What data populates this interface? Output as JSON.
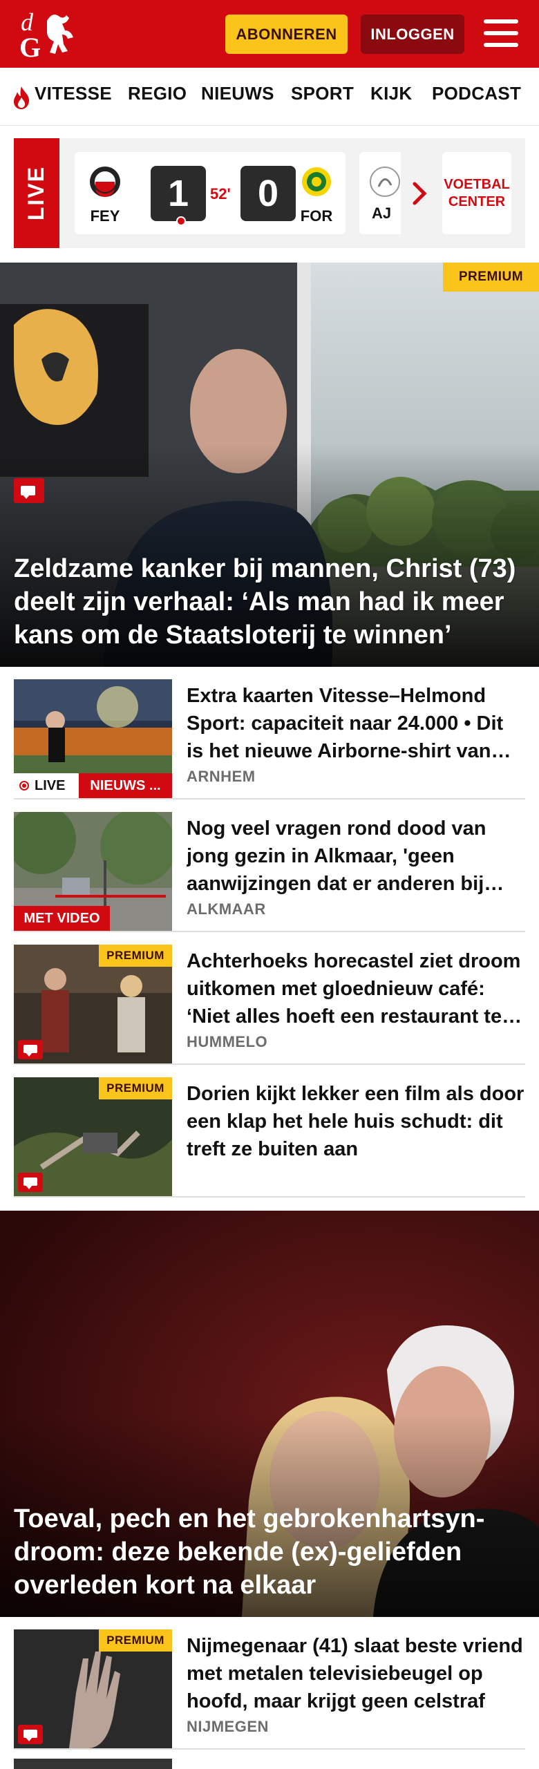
{
  "header": {
    "logo_text": "dG",
    "subscribe_label": "ABONNEREN",
    "login_label": "INLOGGEN",
    "menu_icon": "hamburger-icon",
    "brand_color": "#d10a11"
  },
  "nav": {
    "items": [
      "VITESSE",
      "REGIO",
      "NIEUWS",
      "SPORT",
      "KIJK",
      "PODCAST"
    ]
  },
  "live": {
    "label": "LIVE",
    "home_team": "FEY",
    "away_team": "FOR",
    "home_score": "1",
    "away_score": "0",
    "minute": "52'",
    "next_team": "AJ",
    "center_label_1": "VOETBAL",
    "center_label_2": "CENTER"
  },
  "hero": {
    "badge": "PREMIUM",
    "title": "Zeldzame kanker bij mannen, Christ (73) deelt zijn verhaal: ‘Als man had ik meer kans om de Staatsloterij te winnen’"
  },
  "articles": [
    {
      "title": "Extra kaarten Vitesse–Helmond Sport: capaciteit naar 24.000 • Dit is het nieuwe Airborne-shirt van Vitesse",
      "city": "ARNHEM",
      "live_label": "LIVE",
      "tag": "NIEUWS ..."
    },
    {
      "title": "Nog veel vragen rond dood van jong gezin in Alkmaar, 'geen aanwijzingen dat er anderen bij betrokken zijn'",
      "city": "ALKMAAR",
      "tag": "MET VIDEO"
    },
    {
      "title": "Achterhoeks horecastel ziet droom uitkomen met gloednieuw café: ‘Niet alles hoeft een restaurant te zijn’",
      "city": "HUMMELO",
      "badge": "PREMIUM"
    },
    {
      "title": "Dorien kijkt lekker een film als door een klap het hele huis schudt: dit treft ze buiten aan",
      "city": "",
      "badge": "PREMIUM"
    }
  ],
  "hero2": {
    "title": "Toeval, pech en het gebrokenhartsyn­droom: deze bekende (ex)-geliefden overleden kort na elkaar"
  },
  "article5": {
    "title": "Nijmegenaar (41) slaat beste vriend met metalen televisiebeu­gel op hoofd, maar krijgt geen celstraf",
    "city": "NIJMEGEN",
    "badge": "PREMIUM"
  }
}
